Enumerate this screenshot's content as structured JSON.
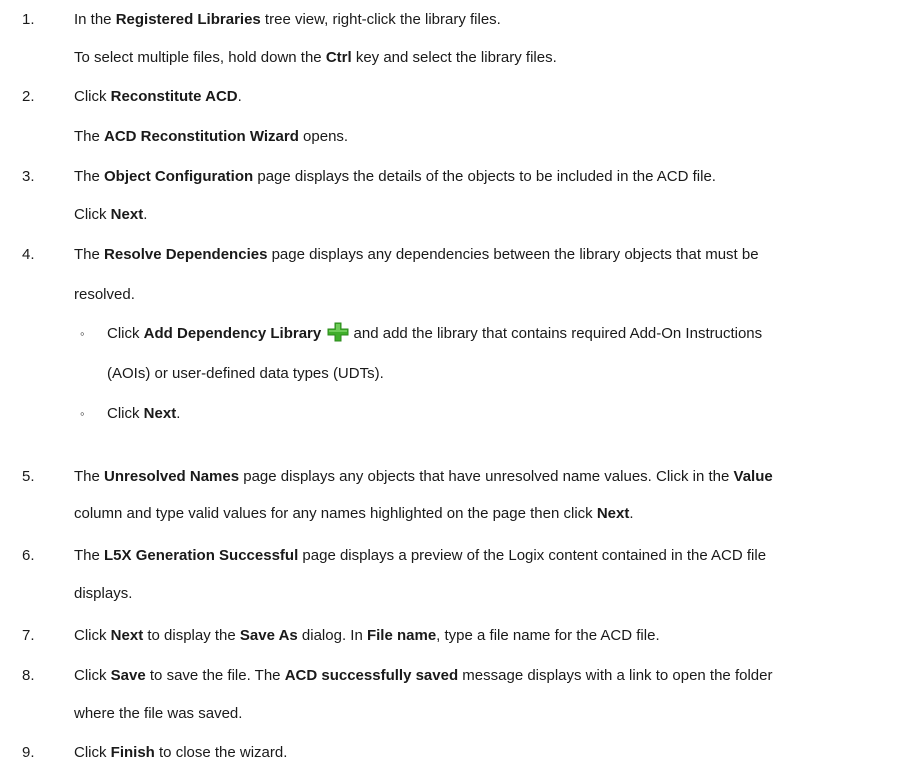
{
  "steps": [
    {
      "num": "1.",
      "lines": [
        {
          "segs": [
            {
              "t": "In the "
            },
            {
              "t": "Registered Libraries",
              "b": true
            },
            {
              "t": " tree view, right-click the library files."
            }
          ]
        },
        {
          "segs": [
            {
              "t": "To select multiple files, hold down the "
            },
            {
              "t": "Ctrl",
              "b": true
            },
            {
              "t": " key and select the library files."
            }
          ]
        }
      ]
    },
    {
      "num": "2.",
      "lines": [
        {
          "segs": [
            {
              "t": "Click "
            },
            {
              "t": "Reconstitute ACD",
              "b": true
            },
            {
              "t": "."
            }
          ]
        },
        {
          "segs": [
            {
              "t": "The "
            },
            {
              "t": "ACD Reconstitution Wizard",
              "b": true
            },
            {
              "t": " opens."
            }
          ]
        }
      ]
    },
    {
      "num": "3.",
      "lines": [
        {
          "segs": [
            {
              "t": "The "
            },
            {
              "t": "Object Configuration",
              "b": true
            },
            {
              "t": " page displays the details of the objects to be included in the ACD file."
            }
          ]
        },
        {
          "segs": [
            {
              "t": "Click "
            },
            {
              "t": "Next",
              "b": true
            },
            {
              "t": "."
            }
          ]
        }
      ]
    },
    {
      "num": "4.",
      "lines": [
        {
          "segs": [
            {
              "t": "The "
            },
            {
              "t": "Resolve Dependencies",
              "b": true
            },
            {
              "t": " page displays any dependencies between the library objects that must be"
            }
          ]
        },
        {
          "segs": [
            {
              "t": "resolved."
            }
          ]
        }
      ],
      "bullets": [
        {
          "bullet": "◦",
          "lines": [
            {
              "segs": [
                {
                  "t": "Click "
                },
                {
                  "t": "Add Dependency Library",
                  "b": true
                },
                {
                  "t": " "
                },
                {
                  "icon": "green-plus-icon"
                },
                {
                  "t": " and add the library that contains required Add-On Instructions"
                }
              ]
            },
            {
              "segs": [
                {
                  "t": "(AOIs) or user-defined data types (UDTs)."
                }
              ]
            }
          ]
        },
        {
          "bullet": "◦",
          "lines": [
            {
              "segs": [
                {
                  "t": "Click "
                },
                {
                  "t": "Next",
                  "b": true
                },
                {
                  "t": "."
                }
              ]
            }
          ]
        }
      ]
    },
    {
      "num": "5.",
      "lines": [
        {
          "segs": [
            {
              "t": "The "
            },
            {
              "t": "Unresolved Names",
              "b": true
            },
            {
              "t": " page displays any objects that have unresolved name values. Click in the "
            },
            {
              "t": "Value",
              "b": true
            }
          ]
        },
        {
          "segs": [
            {
              "t": "column and type valid values for any names highlighted on the page then click "
            },
            {
              "t": "Next",
              "b": true
            },
            {
              "t": "."
            }
          ]
        }
      ]
    },
    {
      "num": "6.",
      "lines": [
        {
          "segs": [
            {
              "t": "The "
            },
            {
              "t": "L5X Generation Successful",
              "b": true
            },
            {
              "t": " page displays a preview of the Logix content contained in the ACD file"
            }
          ]
        },
        {
          "segs": [
            {
              "t": "displays."
            }
          ]
        }
      ]
    },
    {
      "num": "7.",
      "lines": [
        {
          "segs": [
            {
              "t": "Click "
            },
            {
              "t": "Next",
              "b": true
            },
            {
              "t": " to display the "
            },
            {
              "t": "Save As",
              "b": true
            },
            {
              "t": " dialog. In "
            },
            {
              "t": "File name",
              "b": true
            },
            {
              "t": ", type a file name for the ACD file."
            }
          ]
        }
      ]
    },
    {
      "num": "8.",
      "lines": [
        {
          "segs": [
            {
              "t": "Click "
            },
            {
              "t": "Save",
              "b": true
            },
            {
              "t": " to save the file. The "
            },
            {
              "t": "ACD successfully saved",
              "b": true
            },
            {
              "t": " message displays with a link to open the folder"
            }
          ]
        },
        {
          "segs": [
            {
              "t": "where the file was saved."
            }
          ]
        }
      ]
    },
    {
      "num": "9.",
      "lines": [
        {
          "segs": [
            {
              "t": "Click "
            },
            {
              "t": "Finish",
              "b": true
            },
            {
              "t": " to close the wizard."
            }
          ]
        }
      ]
    }
  ]
}
